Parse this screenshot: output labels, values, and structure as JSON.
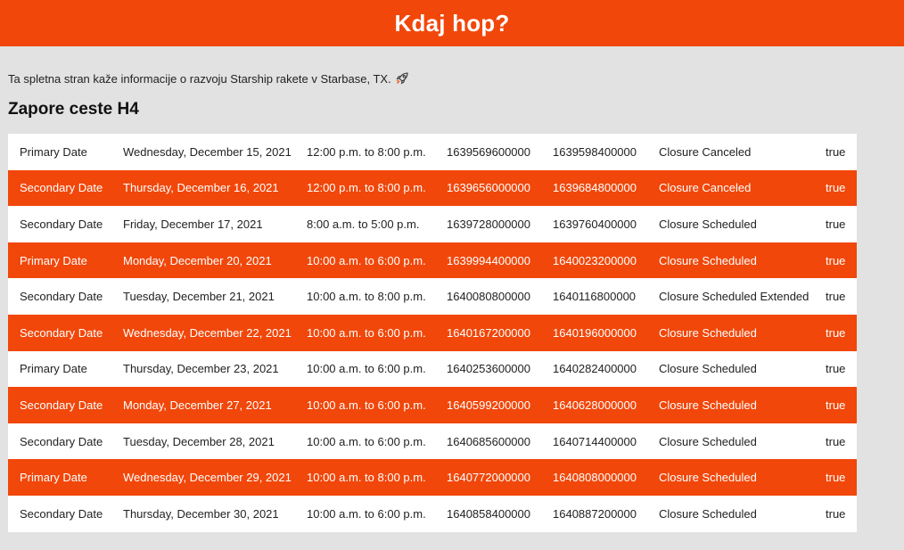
{
  "header": {
    "title": "Kdaj hop?"
  },
  "intro": {
    "text": "Ta spletna stran kaže informacije o razvoju Starship rakete v Starbase, TX.",
    "icon": "rocket-icon"
  },
  "section": {
    "title": "Zapore ceste H4"
  },
  "colors": {
    "accent": "#f1470a",
    "background": "#e2e2e2",
    "row_white": "#ffffff"
  },
  "closures": [
    {
      "type": "Primary Date",
      "date": "Wednesday, December 15, 2021",
      "time": "12:00 p.m. to 8:00 p.m.",
      "start": "1639569600000",
      "end": "1639598400000",
      "status": "Closure Canceled",
      "flag": "true"
    },
    {
      "type": "Secondary Date",
      "date": "Thursday, December 16, 2021",
      "time": "12:00 p.m. to 8:00 p.m.",
      "start": "1639656000000",
      "end": "1639684800000",
      "status": "Closure Canceled",
      "flag": "true"
    },
    {
      "type": "Secondary Date",
      "date": "Friday, December 17, 2021",
      "time": "8:00 a.m. to 5:00 p.m.",
      "start": "1639728000000",
      "end": "1639760400000",
      "status": "Closure Scheduled",
      "flag": "true"
    },
    {
      "type": "Primary Date",
      "date": "Monday, December 20, 2021",
      "time": "10:00 a.m. to 6:00 p.m.",
      "start": "1639994400000",
      "end": "1640023200000",
      "status": "Closure Scheduled",
      "flag": "true"
    },
    {
      "type": "Secondary Date",
      "date": "Tuesday, December 21, 2021",
      "time": "10:00 a.m. to 8:00 p.m.",
      "start": "1640080800000",
      "end": "1640116800000",
      "status": "Closure Scheduled Extended",
      "flag": "true"
    },
    {
      "type": "Secondary Date",
      "date": "Wednesday, December 22, 2021",
      "time": "10:00 a.m. to 6:00 p.m.",
      "start": "1640167200000",
      "end": "1640196000000",
      "status": "Closure Scheduled",
      "flag": "true"
    },
    {
      "type": "Primary Date",
      "date": "Thursday, December 23, 2021",
      "time": "10:00 a.m. to 6:00 p.m.",
      "start": "1640253600000",
      "end": "1640282400000",
      "status": "Closure Scheduled",
      "flag": "true"
    },
    {
      "type": "Secondary Date",
      "date": "Monday, December 27, 2021",
      "time": "10:00 a.m. to 6:00 p.m.",
      "start": "1640599200000",
      "end": "1640628000000",
      "status": "Closure Scheduled",
      "flag": "true"
    },
    {
      "type": "Secondary Date",
      "date": "Tuesday, December 28, 2021",
      "time": "10:00 a.m. to 6:00 p.m.",
      "start": "1640685600000",
      "end": "1640714400000",
      "status": "Closure Scheduled",
      "flag": "true"
    },
    {
      "type": "Primary Date",
      "date": "Wednesday, December 29, 2021",
      "time": "10:00 a.m. to 8:00 p.m.",
      "start": "1640772000000",
      "end": "1640808000000",
      "status": "Closure Scheduled",
      "flag": "true"
    },
    {
      "type": "Secondary Date",
      "date": "Thursday, December 30, 2021",
      "time": "10:00 a.m. to 6:00 p.m.",
      "start": "1640858400000",
      "end": "1640887200000",
      "status": "Closure Scheduled",
      "flag": "true"
    }
  ]
}
